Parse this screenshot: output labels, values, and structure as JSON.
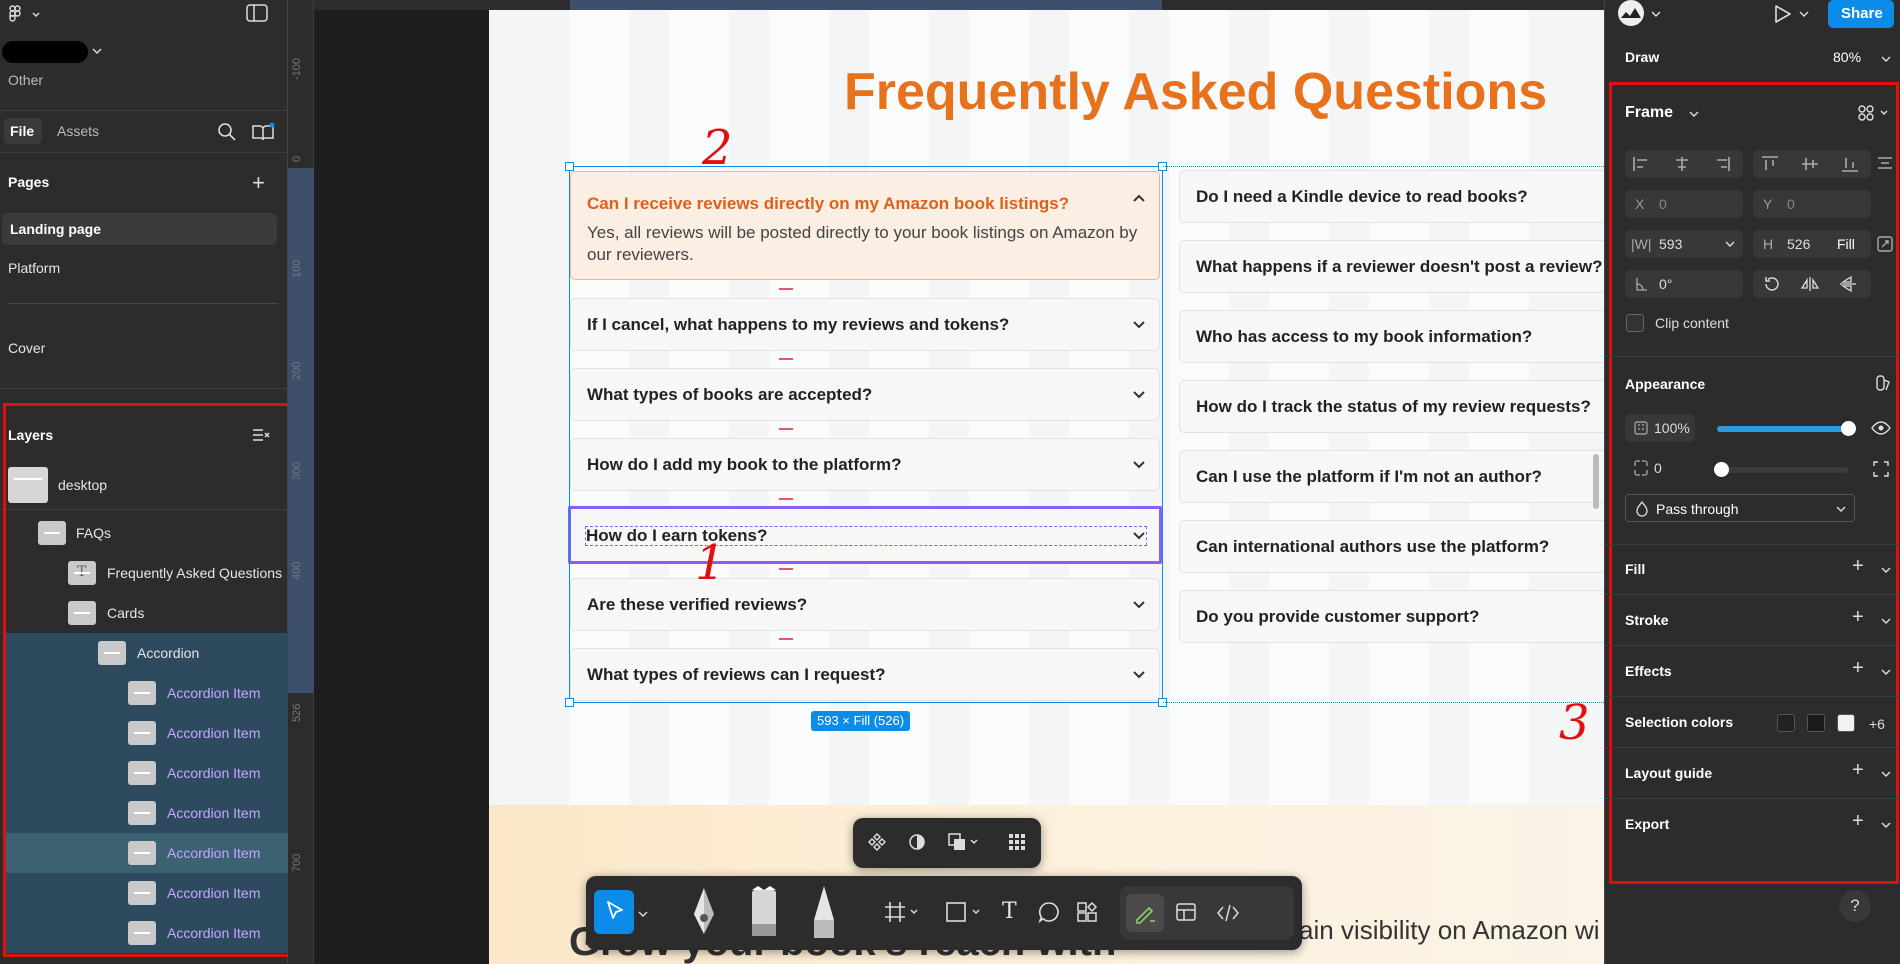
{
  "left_panel": {
    "workspace_name": "Other",
    "tabs": {
      "file": "File",
      "assets": "Assets"
    },
    "pages_header": "Pages",
    "pages": [
      "Landing page",
      "Platform",
      "Cover"
    ],
    "layers_header": "Layers",
    "layers": [
      {
        "name": "desktop",
        "indent": 0
      },
      {
        "name": "FAQs",
        "indent": 1
      },
      {
        "name": "Frequently Asked Questions",
        "indent": 2
      },
      {
        "name": "Cards",
        "indent": 2
      },
      {
        "name": "Accordion",
        "indent": 3
      },
      {
        "name": "Accordion Item",
        "indent": 4
      },
      {
        "name": "Accordion Item",
        "indent": 4
      },
      {
        "name": "Accordion Item",
        "indent": 4
      },
      {
        "name": "Accordion Item",
        "indent": 4
      },
      {
        "name": "Accordion Item",
        "indent": 4
      },
      {
        "name": "Accordion Item",
        "indent": 4
      },
      {
        "name": "Accordion Item",
        "indent": 4
      }
    ]
  },
  "rulers": {
    "vertical_ticks": [
      "-100",
      "0",
      "100",
      "200",
      "300",
      "400",
      "526",
      "700"
    ]
  },
  "canvas": {
    "title": "Frequently Asked Questions",
    "open_item": {
      "question": "Can I receive reviews directly on my Amazon book listings?",
      "answer": "Yes, all reviews will be posted directly to your book listings on Amazon by our reviewers."
    },
    "left_questions": [
      "If I cancel, what happens to my reviews and tokens?",
      "What types of books are accepted?",
      "How do I add my book to the platform?",
      "How do I earn tokens?",
      "Are these verified reviews?",
      "What types of reviews can I request?"
    ],
    "right_questions": [
      "Do I need a Kindle device to read books?",
      "What happens if a reviewer doesn't post a review?",
      "Who has access to my book information?",
      "How do I track the status of my review requests?",
      "Can I use the platform if I'm not an author?",
      "Can international authors use the platform?",
      "Do you provide customer support?"
    ],
    "size_badge": "593 × Fill (526)",
    "bottom_heading": "Grow your book's reach with",
    "bottom_text": "ain visibility on Amazon wi"
  },
  "annotations": [
    "1",
    "2",
    "3"
  ],
  "right_panel": {
    "share_label": "Share",
    "draw_label": "Draw",
    "zoom": "80%",
    "frame_label": "Frame",
    "x_label": "X",
    "x_value": "0",
    "y_label": "Y",
    "y_value": "0",
    "w_label": "W",
    "w_value": "593",
    "h_label": "H",
    "h_value": "526",
    "h_mode": "Fill",
    "rotation": "0°",
    "clip_content": "Clip content",
    "appearance": "Appearance",
    "opacity": "100%",
    "radius": "0",
    "blend_mode": "Pass through",
    "sections": [
      "Fill",
      "Stroke",
      "Effects"
    ],
    "selection_colors": "Selection colors",
    "selection_colors_more": "+6",
    "layout_guide": "Layout guide",
    "export": "Export",
    "help": "?"
  },
  "colors": {
    "accent": "#0c8ce9",
    "title_orange": "#e8721c",
    "selection_purple": "#8b5cf6",
    "annotation_red": "#e01010"
  }
}
